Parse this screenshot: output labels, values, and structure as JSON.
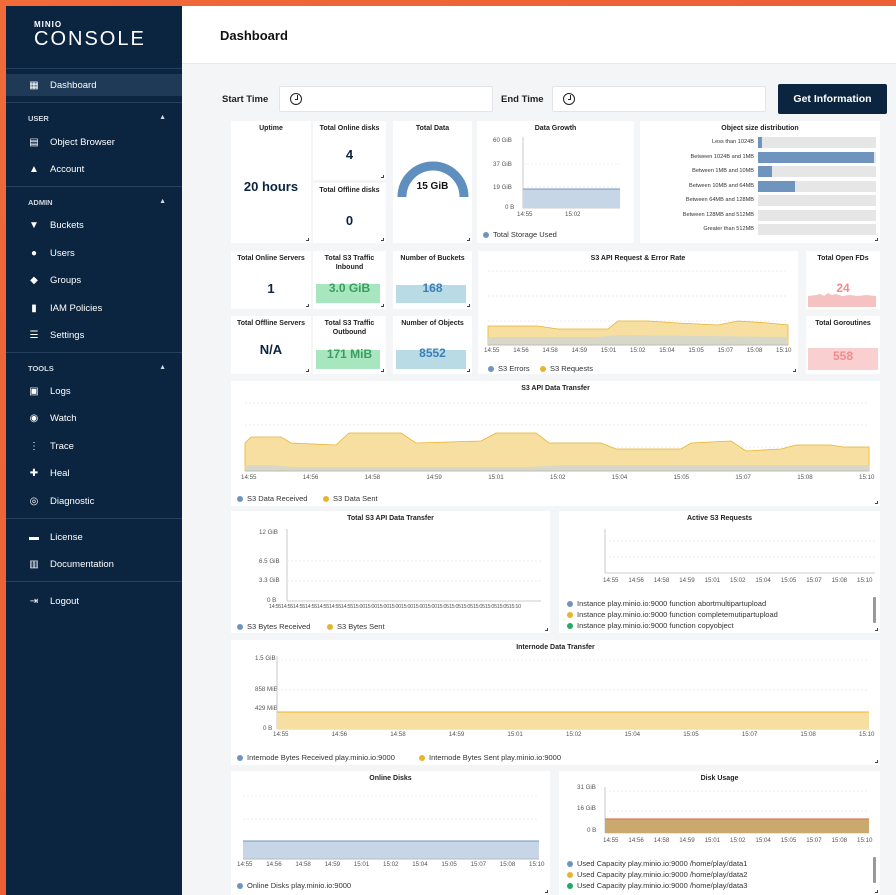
{
  "colors": {
    "sidebar": "#0b2540",
    "accent": "#e8552f",
    "received": "#6f95be",
    "sent": "#e9b42d",
    "s3_traffic": "#5fd38d",
    "buckets": "#9fd0de",
    "open_fds": "#f28b8b",
    "green": "#22aa66"
  },
  "logo": {
    "top": "MINIO",
    "bottom": "CONSOLE"
  },
  "sidebar": {
    "dashboard": "Dashboard",
    "user_section": "USER",
    "user_items": [
      {
        "label": "Object Browser",
        "icon": "file-icon"
      },
      {
        "label": "Account",
        "icon": "account-icon"
      }
    ],
    "admin_section": "ADMIN",
    "admin_items": [
      {
        "label": "Buckets",
        "icon": "bucket-icon"
      },
      {
        "label": "Users",
        "icon": "user-icon"
      },
      {
        "label": "Groups",
        "icon": "groups-icon"
      },
      {
        "label": "IAM Policies",
        "icon": "policy-icon"
      },
      {
        "label": "Settings",
        "icon": "settings-icon"
      }
    ],
    "tools_section": "TOOLS",
    "tools_items": [
      {
        "label": "Logs",
        "icon": "logs-icon"
      },
      {
        "label": "Watch",
        "icon": "watch-icon"
      },
      {
        "label": "Trace",
        "icon": "trace-icon"
      },
      {
        "label": "Heal",
        "icon": "heal-icon"
      },
      {
        "label": "Diagnostic",
        "icon": "diagnostic-icon"
      }
    ],
    "bottom_items": [
      {
        "label": "License",
        "icon": "license-icon"
      },
      {
        "label": "Documentation",
        "icon": "documentation-icon"
      }
    ],
    "logout": "Logout"
  },
  "header": {
    "title": "Dashboard"
  },
  "filters": {
    "start_label": "Start Time",
    "end_label": "End Time",
    "button": "Get Information"
  },
  "cards": {
    "uptime": {
      "title": "Uptime",
      "value": "20 hours"
    },
    "online_disks": {
      "title": "Total Online disks",
      "value": "4"
    },
    "offline_disks": {
      "title": "Total Offline disks",
      "value": "0"
    },
    "total_data": {
      "title": "Total Data",
      "value": "15 GiB"
    },
    "online_servers": {
      "title": "Total Online Servers",
      "value": "1"
    },
    "offline_servers": {
      "title": "Total Offline Servers",
      "value": "N/A"
    },
    "s3_inbound": {
      "title": "Total S3 Traffic Inbound",
      "value": "3.0 GiB"
    },
    "s3_outbound": {
      "title": "Total S3 Traffic Outbound",
      "value": "171 MiB"
    },
    "num_buckets": {
      "title": "Number of Buckets",
      "value": "168"
    },
    "num_objects": {
      "title": "Number of Objects",
      "value": "8552"
    },
    "open_fds": {
      "title": "Total Open FDs",
      "value": "24"
    },
    "goroutines": {
      "title": "Total Goroutines",
      "value": "558"
    }
  },
  "data_growth": {
    "title": "Data Growth",
    "y_ticks": [
      "60 GiB",
      "37 GiB",
      "19 GiB",
      "0 B"
    ],
    "x_ticks": [
      "14:55",
      "15:02"
    ],
    "legend": "Total Storage Used"
  },
  "osd": {
    "title": "Object size distribution",
    "rows": [
      {
        "label": "Less than 1024B",
        "value": 0.03
      },
      {
        "label": "Between 1024B and 1MB",
        "value": 0.98
      },
      {
        "label": "Between 1MB and 10MB",
        "value": 0.12
      },
      {
        "label": "Between 10MB and 64MB",
        "value": 0.31
      },
      {
        "label": "Between 64MB and 128MB",
        "value": 0
      },
      {
        "label": "Between 128MB and 512MB",
        "value": 0
      },
      {
        "label": "Greater than 512MB",
        "value": 0
      }
    ]
  },
  "api_rate": {
    "title": "S3 API Request & Error Rate",
    "x_ticks": [
      "14:55",
      "14:56",
      "14:58",
      "14:59",
      "15:01",
      "15:02",
      "15:04",
      "15:05",
      "15:07",
      "15:08",
      "15:10"
    ],
    "legend": [
      "S3 Errors",
      "S3 Requests"
    ]
  },
  "api_transfer": {
    "title": "S3 API Data Transfer",
    "x_ticks": [
      "14:55",
      "14:56",
      "14:58",
      "14:59",
      "15:01",
      "15:02",
      "15:04",
      "15:05",
      "15:07",
      "15:08",
      "15:10"
    ],
    "legend": [
      "S3 Data Received",
      "S3 Data Sent"
    ]
  },
  "total_transfer": {
    "title": "Total S3 API Data Transfer",
    "y_ticks": [
      "12 GiB",
      "6.5 GiB",
      "3.3 GiB",
      "0 B"
    ],
    "x_ticks_text": "14:5514:5514:5514:5514:5514:5514:5515:0015:0015:0015:0015:0015:0015:0015:0515:0515:0515:0515:0515:0515:10",
    "legend": [
      "S3 Bytes Received",
      "S3 Bytes Sent"
    ]
  },
  "active_requests": {
    "title": "Active S3 Requests",
    "x_ticks": [
      "14:55",
      "14:56",
      "14:58",
      "14:59",
      "15:01",
      "15:02",
      "15:04",
      "15:05",
      "15:07",
      "15:08",
      "15:10"
    ],
    "items": [
      "Instance play.minio.io:9000 function abortmultipartupload",
      "Instance play.minio.io:9000 function completemutipartupload",
      "Instance play.minio.io:9000 function copyobject"
    ]
  },
  "internode": {
    "title": "Internode Data Transfer",
    "y_ticks": [
      "1.5 GiB",
      "858 MiB",
      "429 MiB",
      "0 B"
    ],
    "x_ticks": [
      "14:55",
      "14:56",
      "14:58",
      "14:59",
      "15:01",
      "15:02",
      "15:04",
      "15:05",
      "15:07",
      "15:08",
      "15:10"
    ],
    "legend": [
      "Internode Bytes Received play.minio.io:9000",
      "Internode Bytes Sent play.minio.io:9000"
    ]
  },
  "online_disks_chart": {
    "title": "Online Disks",
    "x_ticks": [
      "14:55",
      "14:56",
      "14:58",
      "14:59",
      "15:01",
      "15:02",
      "15:04",
      "15:05",
      "15:07",
      "15:08",
      "15:10"
    ],
    "legend": "Online Disks play.minio.io:9000"
  },
  "disk_usage": {
    "title": "Disk Usage",
    "y_ticks": [
      "31 GiB",
      "16 GiB",
      "0 B"
    ],
    "x_ticks": [
      "14:55",
      "14:56",
      "14:58",
      "14:59",
      "15:01",
      "15:02",
      "15:04",
      "15:05",
      "15:07",
      "15:08",
      "15:10"
    ],
    "items": [
      "Used Capacity play.minio.io:9000 /home/play/data1",
      "Used Capacity play.minio.io:9000 /home/play/data2",
      "Used Capacity play.minio.io:9000 /home/play/data3"
    ]
  }
}
